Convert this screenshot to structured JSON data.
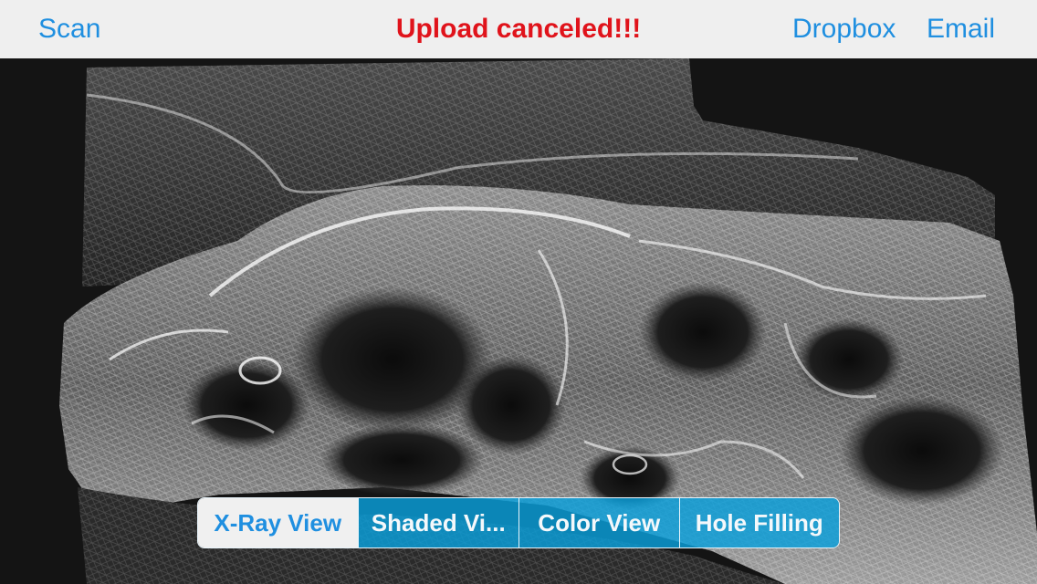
{
  "navbar": {
    "left_button": "Scan",
    "title": "Upload canceled!!!",
    "dropbox_button": "Dropbox",
    "email_button": "Email",
    "title_color": "#e0131b",
    "accent_color": "#1f8fe0"
  },
  "viewport": {
    "content": "3d-scan-mesh-wireframe"
  },
  "view_modes": {
    "selected": "X-Ray View",
    "items": [
      {
        "label": "X-Ray View"
      },
      {
        "label": "Shaded Vi..."
      },
      {
        "label": "Color View"
      },
      {
        "label": "Hole Filling"
      }
    ]
  }
}
